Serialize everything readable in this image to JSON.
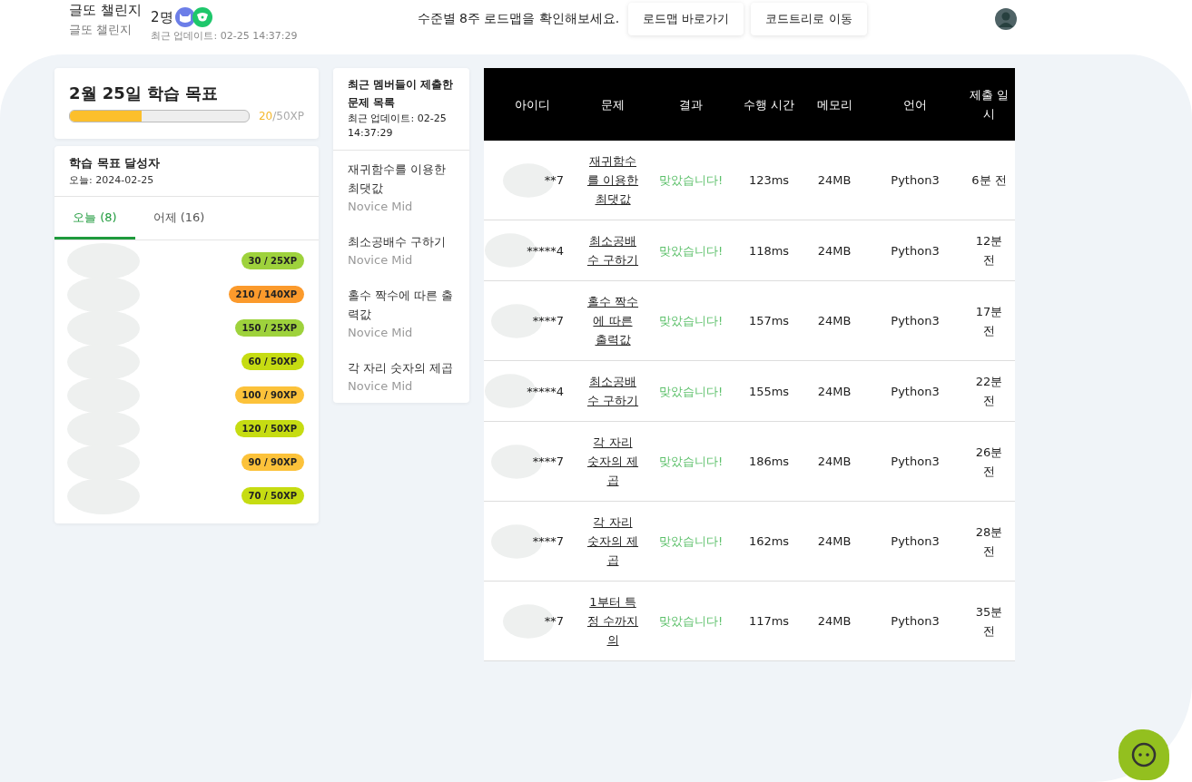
{
  "header": {
    "title": "글또 챌린지",
    "subtitle": "글또 챌린지",
    "members": "2명",
    "updated": "최근 업데이트: 02-25 14:37:29",
    "notice": "수준별 8주 로드맵을 확인해보세요.",
    "buttons": [
      "로드맵 바로가기",
      "코드트리로 이동"
    ]
  },
  "goal": {
    "title": "2월 25일 학습 목표",
    "level": 0.4,
    "current": "20",
    "total": "/50XP"
  },
  "achievers": {
    "title": "학습 목표 달성자",
    "date": "오늘: 2024-02-25",
    "tabs": [
      {
        "label": "오늘 (8)",
        "selected": true
      },
      {
        "label": "어제 (16)",
        "selected": false
      }
    ],
    "rows": [
      {
        "badge": "30 / 25XP",
        "color": "#9ed23c"
      },
      {
        "badge": "210 / 140XP",
        "color": "#fb9a2c"
      },
      {
        "badge": "150 / 25XP",
        "color": "#9ed23c"
      },
      {
        "badge": "60 / 50XP",
        "color": "#c6dc12"
      },
      {
        "badge": "100 / 90XP",
        "color": "#fcc23a"
      },
      {
        "badge": "120 / 50XP",
        "color": "#c6dc12"
      },
      {
        "badge": "90 / 90XP",
        "color": "#fcc23a"
      },
      {
        "badge": "70 / 50XP",
        "color": "#c6dc12"
      }
    ]
  },
  "recent": {
    "title": "최근 멤버들이 제출한 문제 목록",
    "updated": "최근 업데이트: 02-25 14:37:29",
    "items": [
      {
        "name": "재귀함수를 이용한 최댓값",
        "level": "Novice Mid"
      },
      {
        "name": "최소공배수 구하기",
        "level": "Novice Mid"
      },
      {
        "name": "홀수 짝수에 따른 출력값",
        "level": "Novice Mid"
      },
      {
        "name": "각 자리 숫자의 제곱",
        "level": "Novice Mid"
      }
    ]
  },
  "table": {
    "columns": [
      "아이디",
      "문제",
      "결과",
      "수행 시간",
      "메모리",
      "언어",
      "제출 일시"
    ],
    "rows": [
      {
        "id": "**7",
        "problem": "재귀함수를 이용한 최댓값",
        "result": "맞았습니다!",
        "time": "123ms",
        "memory": "24MB",
        "language": "Python3",
        "submitted": "6분 전"
      },
      {
        "id": "*****4",
        "problem": "최소공배수 구하기",
        "result": "맞았습니다!",
        "time": "118ms",
        "memory": "24MB",
        "language": "Python3",
        "submitted": "12분 전"
      },
      {
        "id": "****7",
        "problem": "홀수 짝수에 따른 출력값",
        "result": "맞았습니다!",
        "time": "157ms",
        "memory": "24MB",
        "language": "Python3",
        "submitted": "17분 전"
      },
      {
        "id": "*****4",
        "problem": "최소공배수 구하기",
        "result": "맞았습니다!",
        "time": "155ms",
        "memory": "24MB",
        "language": "Python3",
        "submitted": "22분 전"
      },
      {
        "id": "****7",
        "problem": "각 자리 숫자의 제곱",
        "result": "맞았습니다!",
        "time": "186ms",
        "memory": "24MB",
        "language": "Python3",
        "submitted": "26분 전"
      },
      {
        "id": "****7",
        "problem": "각 자리 숫자의 제곱",
        "result": "맞았습니다!",
        "time": "162ms",
        "memory": "24MB",
        "language": "Python3",
        "submitted": "28분 전"
      },
      {
        "id": "**7",
        "problem": "1부터 특정 수까지의",
        "result": "맞았습니다!",
        "time": "117ms",
        "memory": "24MB",
        "language": "Python3",
        "submitted": "35분 전"
      }
    ]
  }
}
